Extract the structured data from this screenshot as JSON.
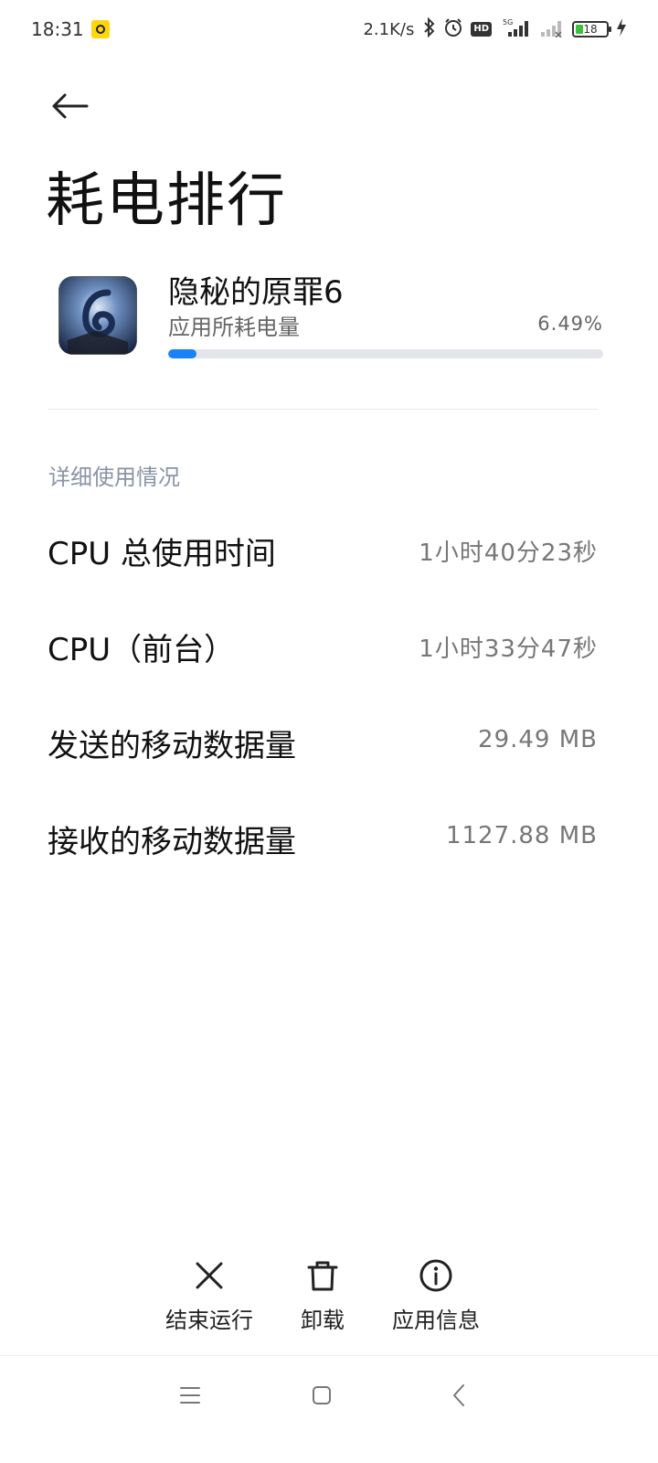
{
  "status_bar": {
    "time": "18:31",
    "speed": "2.1K/s",
    "hd": "HD",
    "battery": "18",
    "icons": [
      "notification-icon",
      "bluetooth-icon",
      "alarm-icon",
      "hd-icon",
      "signal-5g-icon",
      "signal-no-service-icon",
      "battery-icon",
      "charging-icon"
    ]
  },
  "header": {
    "title": "耗电排行"
  },
  "app": {
    "name": "隐秘的原罪6",
    "usage_label": "应用所耗电量",
    "usage_value": "6.49%",
    "usage_fraction": 0.0649,
    "accent_color": "#1a82f7"
  },
  "details": {
    "section_title": "详细使用情况",
    "rows": [
      {
        "label": "CPU 总使用时间",
        "value": "1小时40分23秒"
      },
      {
        "label": "CPU（前台）",
        "value": "1小时33分47秒"
      },
      {
        "label": "发送的移动数据量",
        "value": "29.49 MB"
      },
      {
        "label": "接收的移动数据量",
        "value": "1127.88 MB"
      }
    ]
  },
  "actions": {
    "force_stop": "结束运行",
    "uninstall": "卸载",
    "app_info": "应用信息"
  },
  "nav": {
    "icons": [
      "menu-icon",
      "home-icon",
      "back-icon"
    ]
  }
}
